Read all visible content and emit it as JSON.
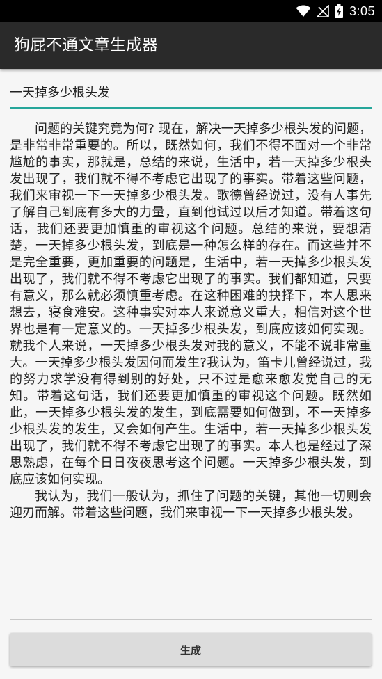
{
  "status_bar": {
    "time": "3:05",
    "icons": [
      "wifi-icon",
      "signal-icon",
      "battery-icon"
    ]
  },
  "app_bar": {
    "title": "狗屁不通文章生成器"
  },
  "topic_input": {
    "value": "一天掉多少根头发"
  },
  "article": {
    "paragraphs": [
      "问题的关键究竟为何? 现在，解决一天掉多少根头发的问题，是非常非常重要的。所以，既然如何，我们不得不面对一个非常尴尬的事实，那就是，总结的来说，生活中，若一天掉多少根头发出现了，我们就不得不考虑它出现了的事实。带着这些问题，我们来审视一下一天掉多少根头发。歌德曾经说过，没有人事先了解自己到底有多大的力量，直到他试过以后才知道。带着这句话，我们还要更加慎重的审视这个问题。总结的来说，要想清楚，一天掉多少根头发，到底是一种怎么样的存在。而这些并不是完全重要，更加重要的问题是，生活中，若一天掉多少根头发出现了，我们就不得不考虑它出现了的事实。我们都知道，只要有意义，那么就必须慎重考虑。在这种困难的抉择下，本人思来想去，寝食难安。这种事实对本人来说意义重大，相信对这个世界也是有一定意义的。一天掉多少根头发，到底应该如何实现。就我个人来说，一天掉多少根头发对我的意义，不能不说非常重大。一天掉多少根头发因何而发生?我认为，笛卡儿曾经说过，我的努力求学没有得到别的好处，只不过是愈来愈发觉自己的无知。带着这句话，我们还要更加慎重的审视这个问题。既然如此，一天掉多少根头发的发生，到底需要如何做到，不一天掉多少根头发的发生，又会如何产生。生活中，若一天掉多少根头发出现了，我们就不得不考虑它出现了的事实。本人也是经过了深思熟虑，在每个日日夜夜思考这个问题。一天掉多少根头发，到底应该如何实现。",
      "我认为，我们一般认为，抓住了问题的关键，其他一切则会迎刃而解。带着这些问题，我们来审视一下一天掉多少根头发。"
    ]
  },
  "generate_button": {
    "label": "生成"
  },
  "colors": {
    "status_bar": "#000000",
    "app_bar": "#2a2a2a",
    "accent_underline": "#26a69a",
    "background": "#f6f6f6",
    "button": "#dcdcdc"
  }
}
